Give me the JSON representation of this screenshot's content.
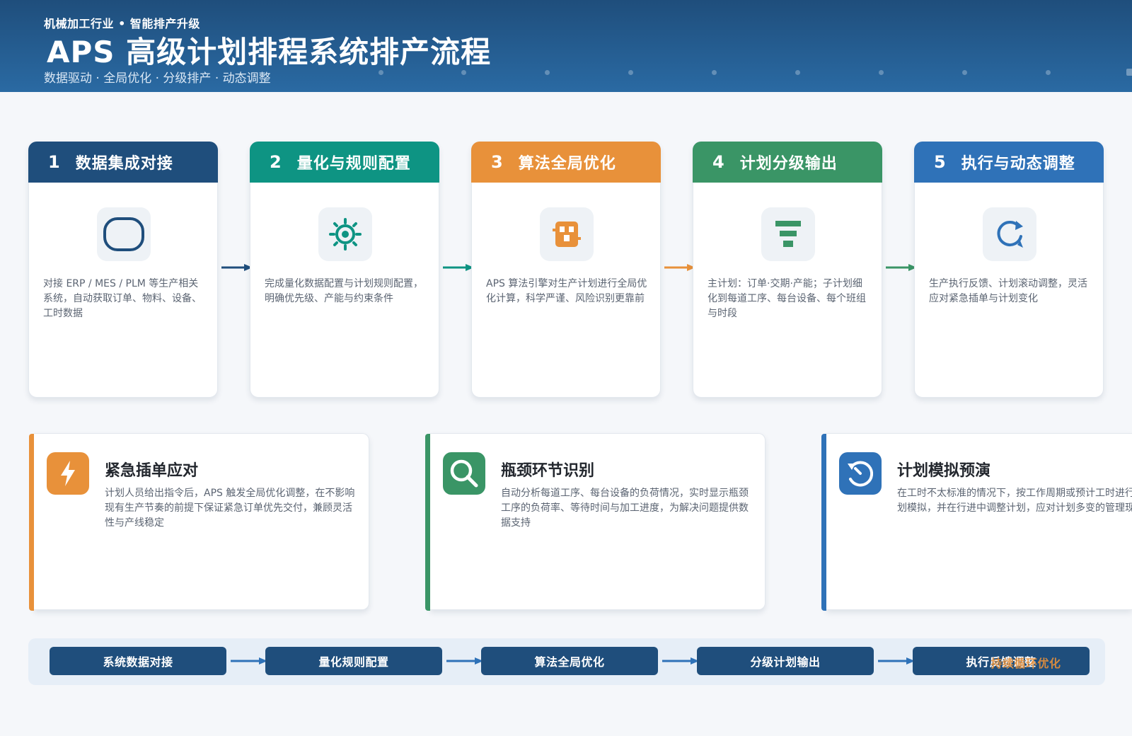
{
  "header": {
    "kicker": "机械加工行业 • 智能排产升级",
    "title": "APS 高级计划排程系统排产流程",
    "subtitle": "数据驱动 · 全局优化 · 分级排产 · 动态调整"
  },
  "steps": [
    {
      "num": "1",
      "name": "数据集成对接",
      "desc": "对接 ERP / MES / PLM 等生产相关系统，自动获取订单、物料、设备、工时数据",
      "color": "#1f4e7c",
      "icon": "database-icon"
    },
    {
      "num": "2",
      "name": "量化与规则配置",
      "desc": "完成量化数据配置与计划规则配置，明确优先级、产能与约束条件",
      "color": "#0e9483",
      "icon": "settings-icon"
    },
    {
      "num": "3",
      "name": "算法全局优化",
      "desc": "APS 算法引擎对生产计划进行全局优化计算，科学严谨、风险识别更靠前",
      "color": "#e8913a",
      "icon": "chip-icon"
    },
    {
      "num": "4",
      "name": "计划分级输出",
      "desc": "主计划：订单·交期·产能；子计划细化到每道工序、每台设备、每个班组与时段",
      "color": "#3a9566",
      "icon": "funnel-icon"
    },
    {
      "num": "5",
      "name": "执行与动态调整",
      "desc": "生产执行反馈、计划滚动调整，灵活应对紧急插单与计划变化",
      "color": "#2f72b8",
      "icon": "refresh-icon"
    }
  ],
  "features": [
    {
      "title": "紧急插单应对",
      "desc": "计划人员给出指令后，APS 触发全局优化调整，在不影响现有生产节奏的前提下保证紧急订单优先交付，兼顾灵活性与产线稳定",
      "color": "#e8913a",
      "icon": "lightning-icon"
    },
    {
      "title": "瓶颈环节识别",
      "desc": "自动分析每道工序、每台设备的负荷情况，实时显示瓶颈工序的负荷率、等待时间与加工进度，为解决问题提供数据支持",
      "color": "#3a9566",
      "icon": "search-icon"
    },
    {
      "title": "计划模拟预演",
      "desc": "在工时不太标准的情况下，按工作周期或预计工时进行计划模拟，并在行进中调整计划，应对计划多变的管理现状",
      "color": "#2f72b8",
      "icon": "simulation-icon"
    }
  ],
  "flow": {
    "items": [
      "系统数据对接",
      "量化规则配置",
      "算法全局优化",
      "分级计划输出",
      "执行反馈调整"
    ],
    "overlay": "持续循环优化",
    "color": "#1f4e7c"
  }
}
